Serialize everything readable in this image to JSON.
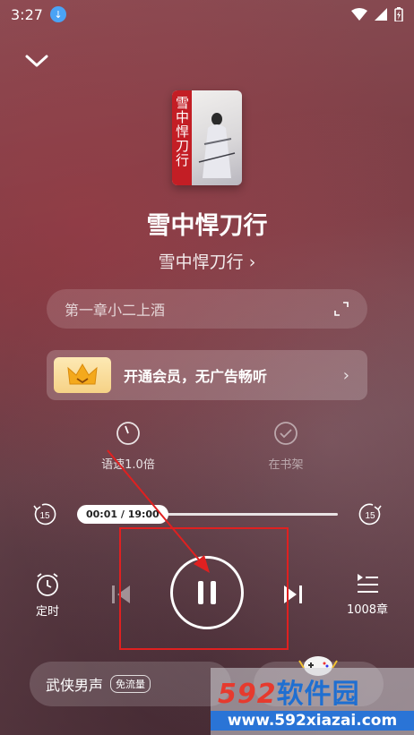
{
  "status": {
    "time": "3:27"
  },
  "book": {
    "title": "雪中悍刀行",
    "author": "雪中悍刀行 ›",
    "cover_text": "雪中悍刀行"
  },
  "chapter": {
    "name": "第一章小二上酒"
  },
  "vip": {
    "text": "开通会员，无广告畅听"
  },
  "options": {
    "speed_label": "语速1.0倍",
    "shelf_label": "在书架"
  },
  "progress": {
    "time_label": "00:01 / 19:00",
    "skip_back": "15",
    "skip_forward": "15",
    "fraction": 0.0
  },
  "controls": {
    "timer_label": "定时",
    "chapters_label": "1008章"
  },
  "voice": {
    "name": "武侠男声",
    "tag": "免流量"
  },
  "watermark": {
    "num": "592",
    "cn": "软件园",
    "url": "www.592xiazai.com"
  },
  "colors": {
    "annotation": "#e02020",
    "vip_gold": "#f6d286"
  }
}
